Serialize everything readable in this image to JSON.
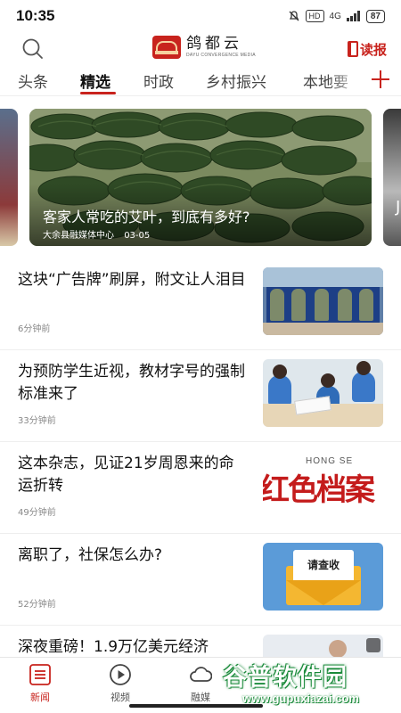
{
  "status_bar": {
    "time": "10:35",
    "hd": "HD",
    "network": "4G",
    "battery": "87"
  },
  "header": {
    "brand_name": "鸽都云",
    "brand_sub": "DAYU CONVERGENCE MEDIA",
    "read_label": "读报"
  },
  "tabs": [
    {
      "label": "头条"
    },
    {
      "label": "精选"
    },
    {
      "label": "时政"
    },
    {
      "label": "乡村振兴"
    },
    {
      "label": "本地要"
    }
  ],
  "active_tab": "精选",
  "carousel": {
    "title": "客家人常吃的艾叶，到底有多好?",
    "source": "大余县融媒体中心",
    "date": "03-05",
    "right_peek_text": "J"
  },
  "news": [
    {
      "title": "这块“广告牌”刷屏，附文让人泪目",
      "time": "6分钟前"
    },
    {
      "title": "为预防学生近视，教材字号的强制标准来了",
      "time": "33分钟前"
    },
    {
      "title": "这本杂志，见证21岁周恩来的命运折转",
      "time": "49分钟前",
      "thumb_text_top": "HONG SE",
      "thumb_text_big": "红色档案"
    },
    {
      "title": "离职了，社保怎么办?",
      "time": "52分钟前",
      "thumb_text": "请查收"
    },
    {
      "title": "深夜重磅！1.9万亿美元经济",
      "time": ""
    }
  ],
  "bottom_nav": [
    {
      "label": "新闻",
      "icon": "news-list-icon"
    },
    {
      "label": "视频",
      "icon": "play-circle-icon"
    },
    {
      "label": "融媒",
      "icon": "cloud-icon"
    }
  ],
  "watermark": {
    "main": "谷普软件园",
    "url": "www.gupuxiazai.com"
  },
  "colors": {
    "accent": "#c8231d",
    "text": "#111111",
    "muted": "#888888"
  }
}
